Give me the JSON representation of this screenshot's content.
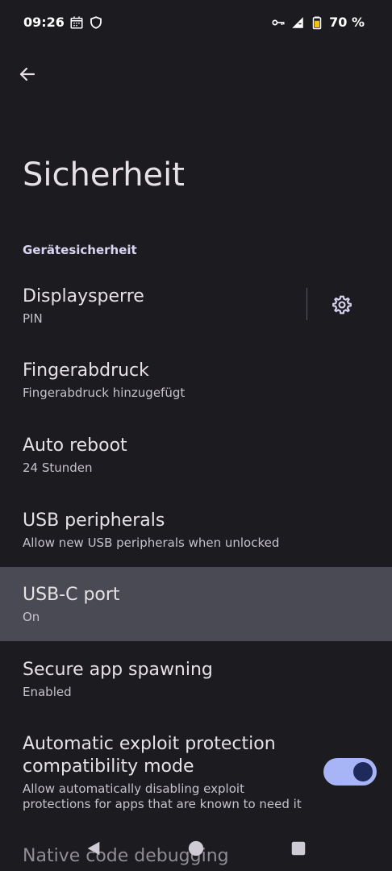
{
  "status_bar": {
    "time": "09:26",
    "battery_percent": "70 %",
    "icons_left": [
      "calendar-icon",
      "shield-icon"
    ],
    "icons_right": [
      "vpn-key-icon",
      "signal-icon",
      "battery-icon"
    ]
  },
  "header": {
    "back_icon": "arrow-back-icon",
    "title": "Sicherheit"
  },
  "section": {
    "header": "Gerätesicherheit"
  },
  "items": [
    {
      "title": "Displaysperre",
      "summary": "PIN",
      "has_settings": true
    },
    {
      "title": "Fingerabdruck",
      "summary": "Fingerabdruck hinzugefügt"
    },
    {
      "title": "Auto reboot",
      "summary": "24 Stunden"
    },
    {
      "title": "USB peripherals",
      "summary": "Allow new USB peripherals when unlocked"
    },
    {
      "title": "USB-C port",
      "summary": "On",
      "highlighted": true
    },
    {
      "title": "Secure app spawning",
      "summary": "Enabled"
    },
    {
      "title_line1": "Automatic exploit protection",
      "title_line2": "compatibility mode",
      "summary_line1": "Allow automatically disabling exploit",
      "summary_line2": "protections for apps that are known to need it",
      "switch_on": true
    },
    {
      "title": "Native code debugging"
    }
  ],
  "colors": {
    "background": "#1c1b1f",
    "highlight": "#4a4a55",
    "switch_track": "#a7b4f5",
    "switch_thumb": "#1f2a5c",
    "section_header": "#d8d4f2"
  },
  "nav_bar": {
    "buttons": [
      "nav-back-icon",
      "nav-home-icon",
      "nav-recents-icon"
    ]
  }
}
